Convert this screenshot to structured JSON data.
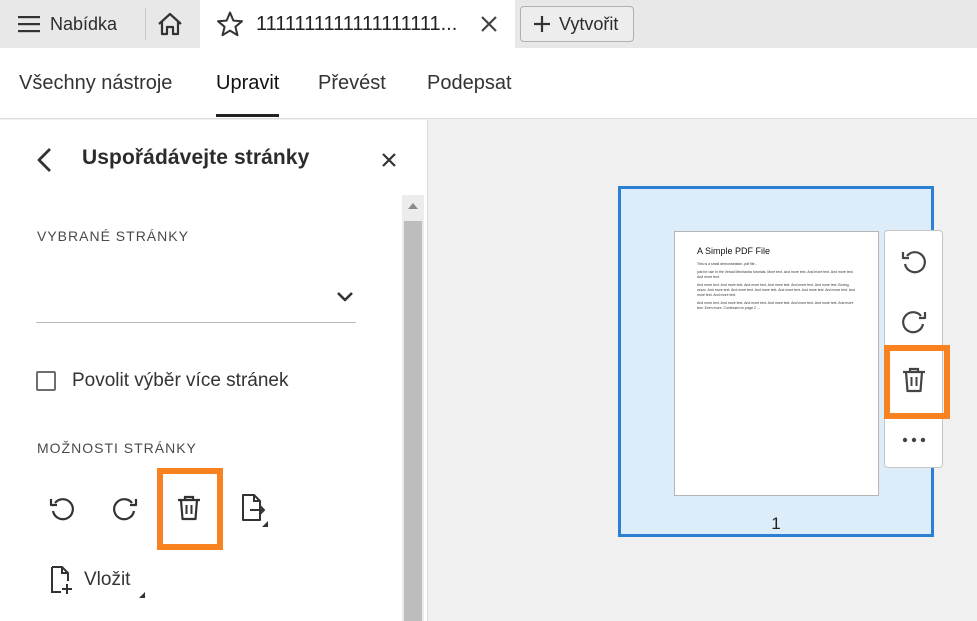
{
  "tabbar": {
    "menu_label": "Nabídka",
    "tab_title": "1111111111111111111...",
    "create_label": "Vytvořit"
  },
  "tools": {
    "tabs": [
      {
        "label": "Všechny nástroje",
        "active": false
      },
      {
        "label": "Upravit",
        "active": true
      },
      {
        "label": "Převést",
        "active": false
      },
      {
        "label": "Podepsat",
        "active": false
      }
    ]
  },
  "panel": {
    "title": "Uspořádávejte stránky",
    "selected_pages_label": "VYBRANÉ STRÁNKY",
    "selected_pages_value": "",
    "multi_select_label": "Povolit výběr více stránek",
    "multi_select_checked": false,
    "page_options_label": "MOŽNOSTI STRÁNKY",
    "insert_label": "Vložit"
  },
  "document": {
    "page_title": "A Simple PDF File",
    "paragraphs": [
      "This is a small demonstration .pdf file -",
      "just for use in the Virtual Mechanics tutorials. More text. And more text. And more text. And more text. And more text.",
      "And more text. And more text. And more text. And more text. And more text. And more text. Boring, zzzzz. And more text. And more text. And more text. And more text. And more text. And more text. And more text. And more text.",
      "And more text. And more text. And more text. And more text. And more text. And more text. And more text. Even more. Continued on page 2 ..."
    ],
    "page_number": "1"
  },
  "colors": {
    "accent_blue": "#2d7fd3",
    "selection_fill": "#dcecf9",
    "highlight_orange": "#f7821f"
  },
  "icons": [
    "hamburger-icon",
    "home-icon",
    "star-icon",
    "close-icon",
    "plus-icon",
    "chevron-left-icon",
    "chevron-down-icon",
    "rotate-left-icon",
    "rotate-right-icon",
    "trash-icon",
    "extract-page-icon",
    "insert-page-icon",
    "more-icon"
  ]
}
